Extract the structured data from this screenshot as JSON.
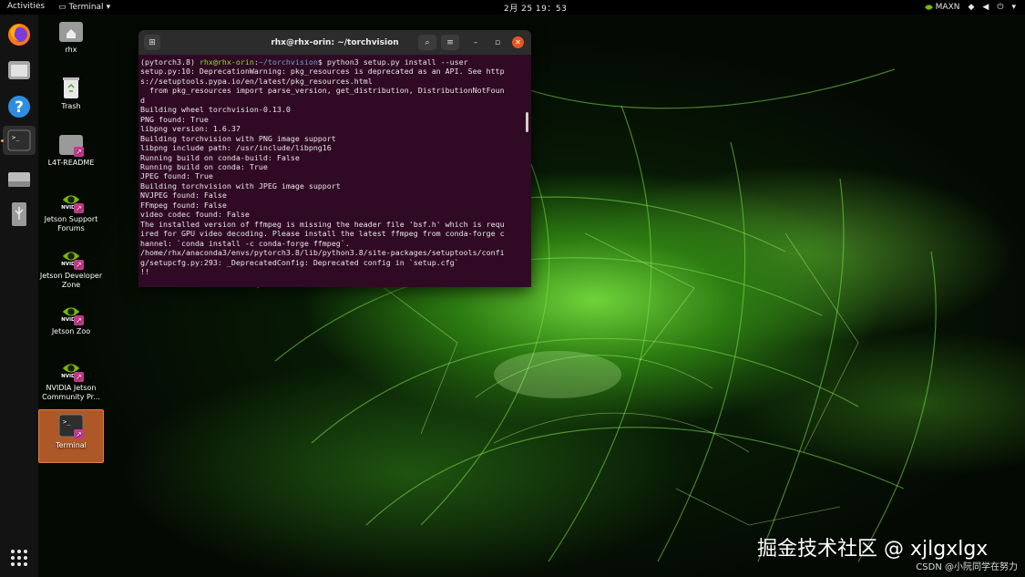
{
  "topbar": {
    "activities": "Activities",
    "app_menu": "Terminal",
    "clock": "2月 25  19：53",
    "power_mode": "MAXN"
  },
  "dock": {
    "items": [
      {
        "name": "firefox",
        "icon": "firefox-icon"
      },
      {
        "name": "files",
        "icon": "folder-icon"
      },
      {
        "name": "help",
        "icon": "help-icon"
      },
      {
        "name": "terminal",
        "icon": "terminal-icon"
      },
      {
        "name": "drive",
        "icon": "drive-icon"
      },
      {
        "name": "usb",
        "icon": "usb-icon"
      }
    ],
    "show_apps": "show-apps-icon"
  },
  "desktop": {
    "icons": [
      {
        "label": "rhx",
        "icon": "home-folder-icon"
      },
      {
        "label": "Trash",
        "icon": "trash-icon"
      },
      {
        "label": "L4T-README",
        "icon": "folder-link-icon"
      },
      {
        "label": "Jetson Support Forums",
        "icon": "nvidia-link-icon"
      },
      {
        "label": "Jetson Developer Zone",
        "icon": "nvidia-link-icon"
      },
      {
        "label": "Jetson Zoo",
        "icon": "nvidia-link-icon"
      },
      {
        "label": "NVIDIA Jetson Community Pr...",
        "icon": "nvidia-link-icon"
      },
      {
        "label": "Terminal",
        "icon": "terminal-icon"
      }
    ]
  },
  "terminal": {
    "title": "rhx@rhx-orin: ~/torchvision",
    "prompt_env": "(pytorch3.8) ",
    "prompt_user": "rhx@rhx-orin",
    "prompt_sep": ":",
    "prompt_path": "~/torchvision",
    "prompt_cmd": "$ python3 setup.py install --user",
    "lines": [
      "setup.py:10: DeprecationWarning: pkg_resources is deprecated as an API. See http",
      "s://setuptools.pypa.io/en/latest/pkg_resources.html",
      "  from pkg_resources import parse_version, get_distribution, DistributionNotFoun",
      "d",
      "Building wheel torchvision-0.13.0",
      "PNG found: True",
      "libpng version: 1.6.37",
      "Building torchvision with PNG image support",
      "libpng include path: /usr/include/libpng16",
      "Running build on conda-build: False",
      "Running build on conda: True",
      "JPEG found: True",
      "Building torchvision with JPEG image support",
      "NVJPEG found: False",
      "FFmpeg found: False",
      "video codec found: False",
      "The installed version of ffmpeg is missing the header file 'bsf.h' which is requ",
      "ired for GPU video decoding. Please install the latest ffmpeg from conda-forge c",
      "hannel: `conda install -c conda-forge ffmpeg`.",
      "/home/rhx/anaconda3/envs/pytorch3.8/lib/python3.8/site-packages/setuptools/confi",
      "g/setupcfg.py:293: _DeprecatedConfig: Deprecated config in `setup.cfg`",
      "!!"
    ]
  },
  "watermark": {
    "main": "掘金技术社区 @ xjlgxlgx",
    "credit": "CSDN @小阮同学在努力"
  },
  "colors": {
    "terminal_bg": "#300a24",
    "prompt_user": "#8ae234",
    "prompt_path": "#729fcf",
    "selection": "#e07b40"
  }
}
